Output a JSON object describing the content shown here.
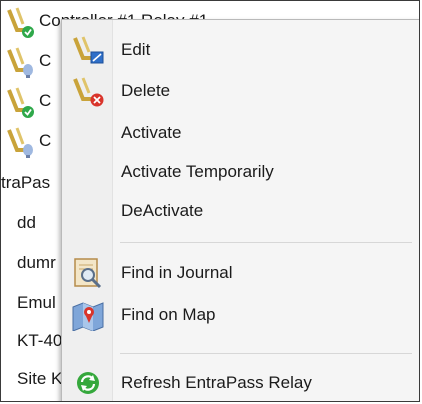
{
  "tree": {
    "items": [
      {
        "label": "Controller #1 Relay #1",
        "icon": "relay-icon",
        "badge": "green-check"
      },
      {
        "label": "C",
        "icon": "relay-icon",
        "badge": "bulb"
      },
      {
        "label": "C",
        "icon": "relay-icon",
        "badge": "green-check"
      },
      {
        "label": "C",
        "icon": "relay-icon",
        "badge": "bulb"
      },
      {
        "label": "traPas",
        "icon": "",
        "badge": ""
      },
      {
        "label": "dd",
        "icon": "",
        "badge": ""
      },
      {
        "label": "dumr",
        "icon": "",
        "badge": ""
      },
      {
        "label": "Emul",
        "icon": "",
        "badge": ""
      },
      {
        "label": "KT-40",
        "icon": "",
        "badge": ""
      },
      {
        "label": "Site K",
        "icon": "",
        "badge": ""
      }
    ]
  },
  "context_menu": {
    "items": [
      {
        "label": "Edit",
        "icon": "edit-relay-icon"
      },
      {
        "label": "Delete",
        "icon": "delete-relay-icon"
      },
      {
        "label": "Activate",
        "icon": ""
      },
      {
        "label": "Activate Temporarily",
        "icon": ""
      },
      {
        "label": "DeActivate",
        "icon": ""
      },
      {
        "label": "Find in Journal",
        "icon": "journal-search-icon"
      },
      {
        "label": "Find on Map",
        "icon": "map-pin-icon"
      },
      {
        "label": "Refresh EntraPass Relay",
        "icon": "refresh-icon"
      }
    ]
  },
  "colors": {
    "menu_bg": "#f5f5f5",
    "check_green": "#2fa84a",
    "delete_red": "#d9342b",
    "edit_blue": "#2f6fc8",
    "refresh_green": "#35a83c"
  }
}
